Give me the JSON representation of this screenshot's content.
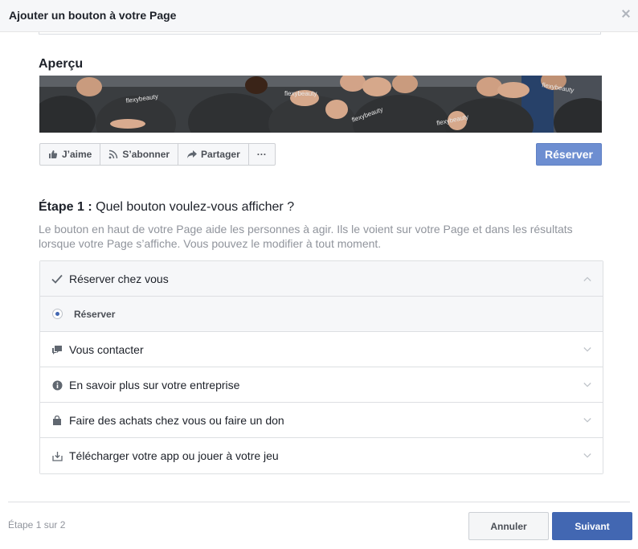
{
  "dialog": {
    "title": "Ajouter un bouton à votre Page"
  },
  "preview": {
    "title": "Aperçu",
    "photo_logo_text": "flexybeauty",
    "actions": [
      {
        "label": "J’aime",
        "icon": "thumbs-up-icon"
      },
      {
        "label": "S’abonner",
        "icon": "rss-icon"
      },
      {
        "label": "Partager",
        "icon": "share-arrow-icon"
      },
      {
        "label": "···",
        "icon": "more-icon"
      }
    ],
    "cta_label": "Réserver"
  },
  "step": {
    "prefix": "Étape 1 :",
    "question": " Quel bouton voulez-vous afficher ?",
    "description": "Le bouton en haut de votre Page aide les personnes à agir. Ils le voient sur votre Page et dans les résultats lorsque votre Page s’affiche. Vous pouvez le modifier à tout moment."
  },
  "options": {
    "items": [
      {
        "label": "Réserver chez vous",
        "icon": "checkmark-icon",
        "expanded": true
      },
      {
        "label": "Réserver",
        "icon": "radio-selected",
        "selected": true
      },
      {
        "label": "Vous contacter",
        "icon": "chat-bubbles-icon"
      },
      {
        "label": "En savoir plus sur votre entreprise",
        "icon": "info-icon"
      },
      {
        "label": "Faire des achats chez vous ou faire un don",
        "icon": "shopping-bag-icon"
      },
      {
        "label": "Télécharger votre app ou jouer à votre jeu",
        "icon": "download-icon"
      }
    ]
  },
  "footer": {
    "step_count": "Étape 1 sur 2",
    "cancel_label": "Annuler",
    "next_label": "Suivant"
  },
  "colors": {
    "primary": "#4267b2",
    "cta_light": "#6d8ed1",
    "text": "#1d2129",
    "muted": "#90949c"
  }
}
